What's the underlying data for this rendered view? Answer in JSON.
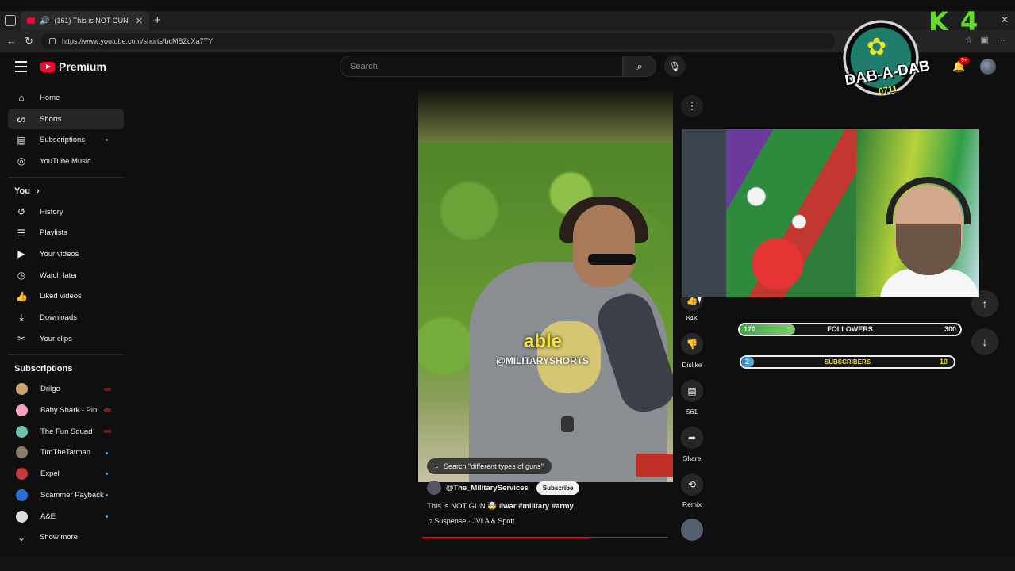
{
  "browser": {
    "tab_title": "(161) This is NOT GUN 🤯 #…",
    "url": "https://www.youtube.com/shorts/bcMBZcXa7TY"
  },
  "masthead": {
    "logo_text": "Premium",
    "search_placeholder": "Search",
    "notifications_badge": "9+",
    "create_label": "ta"
  },
  "sidebar": {
    "main": [
      {
        "label": "Home",
        "icon": "home-icon"
      },
      {
        "label": "Shorts",
        "icon": "shorts-icon",
        "active": true
      },
      {
        "label": "Subscriptions",
        "icon": "subscriptions-icon",
        "dot": true
      },
      {
        "label": "YouTube Music",
        "icon": "music-icon"
      }
    ],
    "you_heading": "You",
    "you": [
      {
        "label": "History",
        "icon": "history-icon"
      },
      {
        "label": "Playlists",
        "icon": "playlists-icon"
      },
      {
        "label": "Your videos",
        "icon": "your-videos-icon"
      },
      {
        "label": "Watch later",
        "icon": "watch-later-icon"
      },
      {
        "label": "Liked videos",
        "icon": "liked-icon"
      },
      {
        "label": "Downloads",
        "icon": "downloads-icon"
      },
      {
        "label": "Your clips",
        "icon": "clips-icon"
      }
    ],
    "subs_heading": "Subscriptions",
    "subscriptions": [
      {
        "label": "Drilgo",
        "color": "#c9a36b",
        "marker": "live"
      },
      {
        "label": "Baby Shark - Pin...",
        "color": "#f2a3c4",
        "marker": "live"
      },
      {
        "label": "The Fun Squad",
        "color": "#6cc4b0",
        "marker": "live"
      },
      {
        "label": "TimTheTatman",
        "color": "#8a7c66",
        "marker": "dot"
      },
      {
        "label": "Expel",
        "color": "#c23a3a",
        "marker": "dot"
      },
      {
        "label": "Scammer Payback",
        "color": "#2b6fd6",
        "marker": "dot"
      },
      {
        "label": "A&E",
        "color": "#dddddd",
        "marker": "dot"
      }
    ],
    "show_more": "Show more"
  },
  "short": {
    "caption_big": "able",
    "caption_small": "@MILITARYSHORTS",
    "search_chip": "Search \"different types of guns\"",
    "channel": "@The_MilitaryServices",
    "subscribe": "Subscribe",
    "title_plain": "This is NOT GUN 🤯 ",
    "title_tags": "#war #military #army",
    "music": "Suspense · JVLA & Spott",
    "progress": 0.68
  },
  "actions": {
    "likes": "84K",
    "dislike": "Dislike",
    "comments": "561",
    "share": "Share",
    "remix": "Remix"
  },
  "overlay": {
    "followers_left": "170",
    "followers_label": "FOLLOWERS",
    "followers_right": "300",
    "followers_progress": 0.25,
    "subs_left": "2",
    "subs_label": "SUBSCRIBERS",
    "subs_right": "10",
    "subs_progress": 0.06,
    "dab_text": "DAB-A-DAB",
    "dab_num": "0711",
    "k4_k": "K",
    "k4_4": "4"
  }
}
